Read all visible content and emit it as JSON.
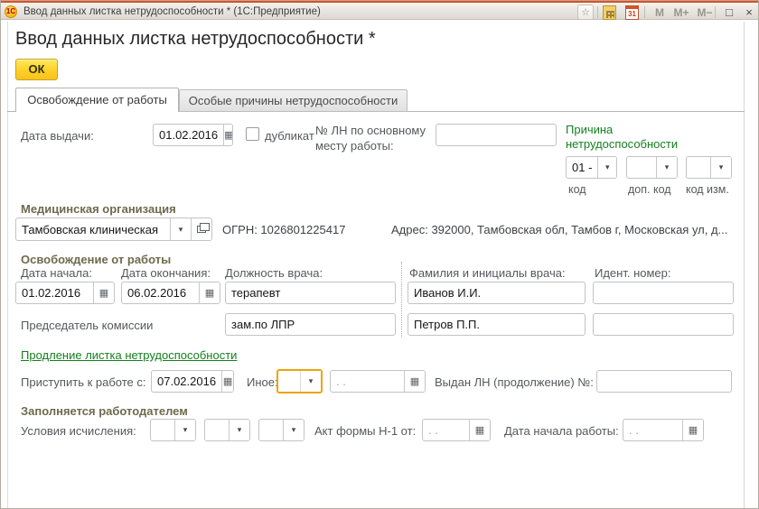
{
  "window": {
    "title": "Ввод данных листка нетрудоспособности *  (1С:Предприятие)",
    "app_icon_text": "1С",
    "calendar_day": "31",
    "memory_label": "M",
    "memory_plus_label": "M+",
    "memory_minus_label": "M−",
    "maximize_glyph": "□",
    "close_glyph": "×",
    "favorites_glyph": "☆"
  },
  "icons": {
    "calendar": "▦",
    "dropdown": "▾"
  },
  "page": {
    "title": "Ввод данных листка нетрудоспособности *",
    "ok_label": "ОК"
  },
  "tabs": [
    {
      "label": "Освобождение от работы"
    },
    {
      "label": "Особые причины нетрудоспособности"
    }
  ],
  "issue": {
    "date_label": "Дата выдачи:",
    "date_value": "01.02.2016",
    "duplicate_label": "дубликат",
    "ln_main_label_line1": "№ ЛН по основному",
    "ln_main_label_line2": "месту работы:",
    "ln_main_value": "",
    "cause_title_line1": "Причина",
    "cause_title_line2": "нетрудоспособности",
    "cause_code_value": "01 -",
    "cause_add_code_value": "",
    "cause_change_code_value": "",
    "code_label": "код",
    "add_code_label": "доп. код",
    "change_code_label": "код изм."
  },
  "med_org": {
    "section_title": "Медицинская организация",
    "org_value": "Тамбовская клиническая",
    "ogrn_text": "ОГРН: 1026801225417",
    "address_text": "Адрес: 392000, Тамбовская обл, Тамбов г, Московская ул, д..."
  },
  "release": {
    "section_title": "Освобождение от работы",
    "start_label": "Дата начала:",
    "start_value": "01.02.2016",
    "end_label": "Дата окончания:",
    "end_value": "06.02.2016",
    "position_label": "Должность врача:",
    "position_value": "терапевт",
    "doctor_label": "Фамилия и инициалы врача:",
    "doctor_value": "Иванов И.И.",
    "id_label": "Идент.  номер:",
    "id_value": "",
    "chairman_label": "Председатель комиссии",
    "chairman_position_value": "зам.по ЛПР",
    "chairman_name_value": "Петров П.П.",
    "chairman_id_value": ""
  },
  "extension": {
    "link_label": "Продление листка нетрудоспособности"
  },
  "resume": {
    "resume_label": "Приступить к работе с:",
    "resume_value": "07.02.2016",
    "other_label": "Иное:",
    "other_value": "",
    "other_date_placeholder": ". .",
    "issued_label": "Выдан ЛН (продолжение) №:",
    "issued_value": ""
  },
  "employer": {
    "section_title": "Заполняется работодателем",
    "calc_conditions_label": "Условия исчисления:",
    "cond1_value": "",
    "cond2_value": "",
    "cond3_value": "",
    "act_label": "Акт формы Н-1 от:",
    "act_date_placeholder": ". .",
    "work_start_label": "Дата начала работы:",
    "work_start_placeholder": ". ."
  }
}
